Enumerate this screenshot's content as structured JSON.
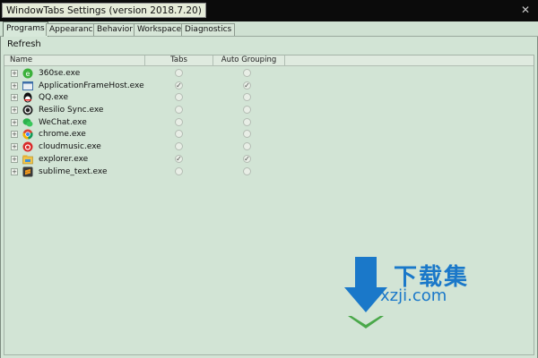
{
  "window": {
    "title": "WindowTabs Settings (version 2018.7.20)",
    "close_glyph": "✕"
  },
  "tabs": [
    {
      "label": "Programs",
      "active": true
    },
    {
      "label": "Appearance",
      "active": false
    },
    {
      "label": "Behavior",
      "active": false
    },
    {
      "label": "Workspace",
      "active": false
    },
    {
      "label": "Diagnostics",
      "active": false
    }
  ],
  "toolbar": {
    "refresh_label": "Refresh"
  },
  "columns": {
    "name": "Name",
    "tabs": "Tabs",
    "auto_grouping": "Auto Grouping"
  },
  "programs": [
    {
      "name": "360se.exe",
      "icon": "360se-icon",
      "tabs": false,
      "auto": false
    },
    {
      "name": "ApplicationFrameHost.exe",
      "icon": "app-frame-icon",
      "tabs": true,
      "auto": true
    },
    {
      "name": "QQ.exe",
      "icon": "qq-icon",
      "tabs": false,
      "auto": false
    },
    {
      "name": "Resilio Sync.exe",
      "icon": "resilio-icon",
      "tabs": false,
      "auto": false
    },
    {
      "name": "WeChat.exe",
      "icon": "wechat-icon",
      "tabs": false,
      "auto": false
    },
    {
      "name": "chrome.exe",
      "icon": "chrome-icon",
      "tabs": false,
      "auto": false
    },
    {
      "name": "cloudmusic.exe",
      "icon": "cloudmusic-icon",
      "tabs": false,
      "auto": false
    },
    {
      "name": "explorer.exe",
      "icon": "explorer-icon",
      "tabs": true,
      "auto": true
    },
    {
      "name": "sublime_text.exe",
      "icon": "sublime-icon",
      "tabs": false,
      "auto": false
    }
  ],
  "watermark": {
    "cn": "下载集",
    "site": "xzji.com"
  },
  "colors": {
    "panel": "#d2e4d5",
    "titlebar": "#0b0b0b",
    "watermark": "#1a78c9"
  }
}
